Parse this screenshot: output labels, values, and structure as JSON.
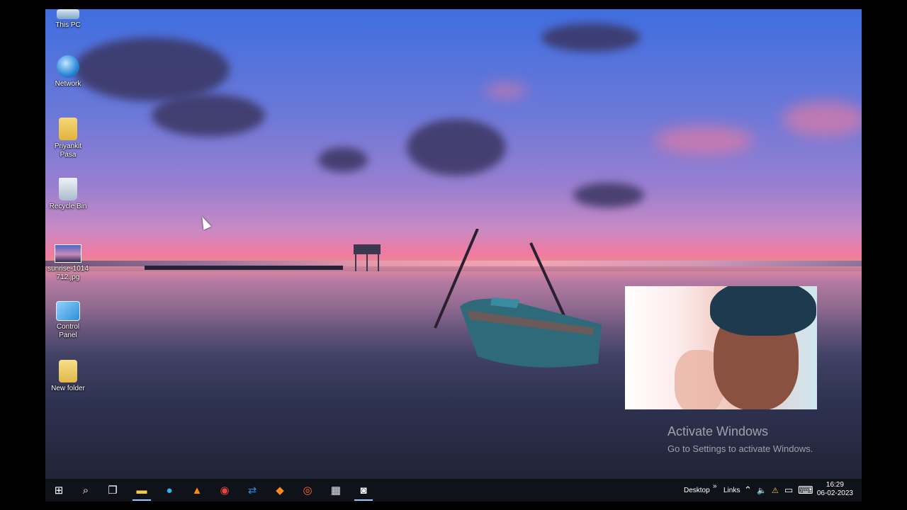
{
  "desktop": {
    "icons": [
      {
        "label": "This PC",
        "icon": "this-pc-icon"
      },
      {
        "label": "Network",
        "icon": "network-icon"
      },
      {
        "label": "Priyankit\nPasa",
        "icon": "user-folder-icon"
      },
      {
        "label": "Recycle Bin",
        "icon": "recycle-bin-icon"
      },
      {
        "label": "sunrise-1014\n712.jpg",
        "icon": "image-file-icon"
      },
      {
        "label": "Control\nPanel",
        "icon": "control-panel-icon"
      },
      {
        "label": "New folder",
        "icon": "folder-icon"
      }
    ]
  },
  "watermark": {
    "title": "Activate Windows",
    "subtitle": "Go to Settings to activate Windows."
  },
  "taskbar": {
    "pinned": [
      {
        "name": "start-button",
        "icon": "windows-logo-icon",
        "glyph": "⊞"
      },
      {
        "name": "search-button",
        "icon": "search-icon",
        "glyph": "⌕"
      },
      {
        "name": "task-view-button",
        "icon": "task-view-icon",
        "glyph": "❐"
      },
      {
        "name": "file-explorer-button",
        "icon": "file-explorer-icon",
        "glyph": "▬"
      },
      {
        "name": "edge-button",
        "icon": "edge-icon",
        "glyph": "●"
      },
      {
        "name": "vlc-button",
        "icon": "vlc-icon",
        "glyph": "▲"
      },
      {
        "name": "chrome-button",
        "icon": "chrome-icon",
        "glyph": "◉"
      },
      {
        "name": "teamviewer-button",
        "icon": "teamviewer-icon",
        "glyph": "⇄"
      },
      {
        "name": "app-orange-button",
        "icon": "orange-app-icon",
        "glyph": "◆"
      },
      {
        "name": "firefox-button",
        "icon": "firefox-icon",
        "glyph": "◎"
      },
      {
        "name": "video-editor-button",
        "icon": "clapperboard-icon",
        "glyph": "▦"
      },
      {
        "name": "camera-button",
        "icon": "camera-icon",
        "glyph": "◙"
      }
    ],
    "toolbars": {
      "desktop": "Desktop",
      "chevron": "»",
      "links": "Links"
    },
    "tray_glyphs": {
      "up": "⌃",
      "volume": "🔈",
      "network": "⚠",
      "notification": "▭",
      "keyboard": "⌨"
    },
    "clock": {
      "time": "16:29",
      "date": "06-02-2023"
    }
  },
  "colors": {
    "taskbar_bg": "#10121a",
    "active_indicator": "#9cc4ff"
  }
}
